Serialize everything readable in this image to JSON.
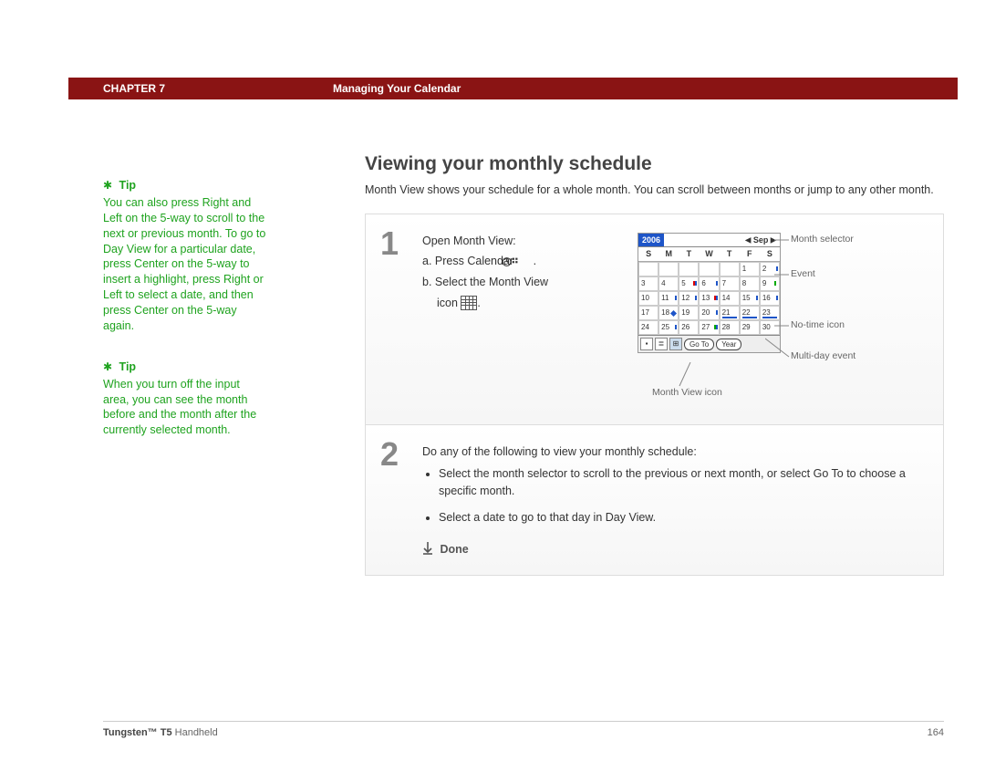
{
  "header": {
    "chapter_label": "CHAPTER 7",
    "chapter_title": "Managing Your Calendar"
  },
  "sidebar": {
    "tips": [
      {
        "heading": "Tip",
        "body": "You can also press Right and Left on the 5-way to scroll to the next or previous month. To go to Day View for a particular date, press Center on the 5-way to insert a highlight, press Right or Left to select a date, and then press Center on the 5-way again."
      },
      {
        "heading": "Tip",
        "body": "When you turn off the input area, you can see the month before and the month after the currently selected month."
      }
    ]
  },
  "main": {
    "heading": "Viewing your monthly schedule",
    "intro": "Month View shows your schedule for a whole month. You can scroll between months or jump to any other month.",
    "steps": [
      {
        "num": "1",
        "lead": "Open Month View:",
        "a_prefix": "a.",
        "a_text": "Press Calendar",
        "a_period": ".",
        "b_prefix": "b.",
        "b_text": "Select the Month View",
        "b_icon_word": "icon",
        "b_period": "."
      },
      {
        "num": "2",
        "lead": "Do any of the following to view your monthly schedule:",
        "bullets": [
          "Select the month selector to scroll to the previous or next month, or select Go To to choose a specific month.",
          "Select a date to go to that day in Day View."
        ],
        "done": "Done"
      }
    ]
  },
  "pda": {
    "year": "2006",
    "month": "Sep",
    "dow": [
      "S",
      "M",
      "T",
      "W",
      "T",
      "F",
      "S"
    ],
    "goto": "Go To",
    "year_btn": "Year"
  },
  "annotations": {
    "month_selector": "Month selector",
    "event": "Event",
    "no_time": "No-time icon",
    "multi_day": "Multi-day event",
    "month_view_icon": "Month View icon"
  },
  "footer": {
    "product_bold": "Tungsten™ T5",
    "product_rest": " Handheld",
    "page": "164"
  },
  "chart_data": {
    "type": "table",
    "title": "September 2006 Month View calendar",
    "columns": [
      "S",
      "M",
      "T",
      "W",
      "T",
      "F",
      "S"
    ],
    "rows": [
      [
        "",
        "",
        "",
        "",
        "",
        "1",
        "2"
      ],
      [
        "3",
        "4",
        "5",
        "6",
        "7",
        "8",
        "9"
      ],
      [
        "10",
        "11",
        "12",
        "13",
        "14",
        "15",
        "16"
      ],
      [
        "17",
        "18",
        "19",
        "20",
        "21",
        "22",
        "23"
      ],
      [
        "24",
        "25",
        "26",
        "27",
        "28",
        "29",
        "30"
      ]
    ],
    "cell_markers": {
      "2": [
        "event"
      ],
      "5": [
        "event-red",
        "event"
      ],
      "6": [
        "event"
      ],
      "9": [
        "event-green"
      ],
      "11": [
        "event"
      ],
      "12": [
        "event"
      ],
      "13": [
        "event-red",
        "event"
      ],
      "15": [
        "event"
      ],
      "16": [
        "event"
      ],
      "18": [
        "no-time-diamond"
      ],
      "20": [
        "event"
      ],
      "21": [
        "multi-day-bar"
      ],
      "22": [
        "multi-day-bar"
      ],
      "23": [
        "multi-day-bar"
      ],
      "25": [
        "event"
      ],
      "27": [
        "event-green",
        "event"
      ]
    }
  }
}
